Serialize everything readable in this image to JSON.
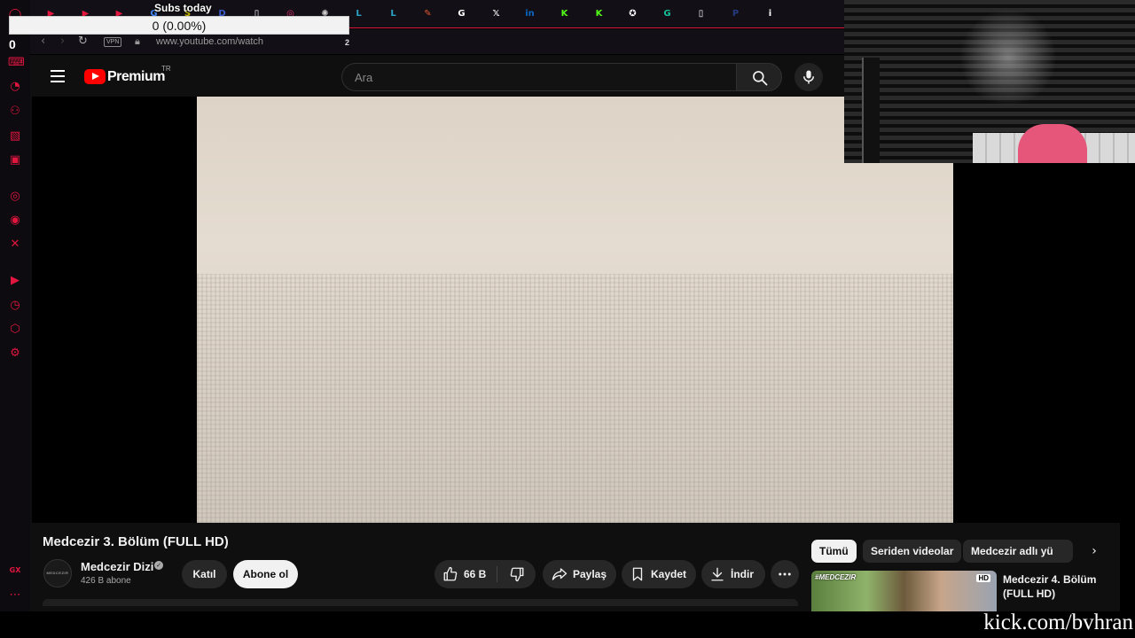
{
  "overlay": {
    "subs_title": "Subs today",
    "subs_progress_text": "0 (0.00%)",
    "subs_progress_fraction": 0.0,
    "stream_counter": "0",
    "watermark": "kick.com/bvhran"
  },
  "browser": {
    "url": "www.youtube.com/watch",
    "vpn_label": "VPN",
    "tab_count": "2",
    "accent_color": "#e0163f",
    "tabs": [
      {
        "icon": "youtube-icon",
        "glyph": "▶",
        "color": "#e0163f"
      },
      {
        "icon": "youtube-icon",
        "glyph": "▶",
        "color": "#e0163f"
      },
      {
        "icon": "youtube-icon",
        "glyph": "▶",
        "color": "#e0163f"
      },
      {
        "icon": "google-icon",
        "glyph": "G",
        "color": "#4285f4"
      },
      {
        "icon": "steam-icon",
        "glyph": "S",
        "color": "#c7b800"
      },
      {
        "icon": "document-icon",
        "glyph": "D",
        "color": "#3b5bcc"
      },
      {
        "icon": "file-icon",
        "glyph": "▯",
        "color": "#ffffff"
      },
      {
        "icon": "instagram-icon",
        "glyph": "◎",
        "color": "#e1306c"
      },
      {
        "icon": "chatgpt-icon",
        "glyph": "✺",
        "color": "#cccccc"
      },
      {
        "icon": "letter-l-icon",
        "glyph": "L",
        "color": "#2aa3c7"
      },
      {
        "icon": "letter-l-icon",
        "glyph": "L",
        "color": "#2aa3c7"
      },
      {
        "icon": "paint-icon",
        "glyph": "✎",
        "color": "#e4572e"
      },
      {
        "icon": "google-icon",
        "glyph": "G",
        "color": "#ffffff"
      },
      {
        "icon": "x-icon",
        "glyph": "𝕏",
        "color": "#ffffff"
      },
      {
        "icon": "linkedin-icon",
        "glyph": "in",
        "color": "#0a66c2"
      },
      {
        "icon": "kick-icon",
        "glyph": "K",
        "color": "#53fc18"
      },
      {
        "icon": "kick-icon",
        "glyph": "K",
        "color": "#53fc18"
      },
      {
        "icon": "star-icon",
        "glyph": "✪",
        "color": "#ffffff"
      },
      {
        "icon": "grammarly-icon",
        "glyph": "G",
        "color": "#15c39a"
      },
      {
        "icon": "file-icon",
        "glyph": "▯",
        "color": "#ffffff"
      },
      {
        "icon": "paypal-icon",
        "glyph": "P",
        "color": "#253b80"
      },
      {
        "icon": "info-icon",
        "glyph": "i",
        "color": "#ffffff"
      }
    ],
    "sidebar_icons": [
      {
        "icon": "game-controller-icon",
        "glyph": "⌨"
      },
      {
        "icon": "speed-icon",
        "glyph": "◔"
      },
      {
        "icon": "bot-icon",
        "glyph": "⚇"
      },
      {
        "icon": "twitch-icon",
        "glyph": "▧"
      },
      {
        "icon": "mail-icon",
        "glyph": "▣"
      },
      {
        "icon": "instagram-icon",
        "glyph": "◎"
      },
      {
        "icon": "whatsapp-icon",
        "glyph": "◉"
      },
      {
        "icon": "x-icon",
        "glyph": "✕"
      },
      {
        "icon": "player-icon",
        "glyph": "▶"
      },
      {
        "icon": "history-icon",
        "glyph": "◷"
      },
      {
        "icon": "extensions-icon",
        "glyph": "⬡"
      },
      {
        "icon": "settings-icon",
        "glyph": "⚙"
      },
      {
        "icon": "gx-icon",
        "glyph": "GX"
      },
      {
        "icon": "more-icon",
        "glyph": "⋯"
      }
    ]
  },
  "youtube": {
    "logo_text": "Premium",
    "logo_region": "TR",
    "brand_color": "#ff0000",
    "search_placeholder": "Ara",
    "video": {
      "title": "Medcezir 3. Bölüm (FULL HD)",
      "channel": "Medcezir Dizi",
      "avatar_text": "MEDCEZIR",
      "subscribers": "426 B abone",
      "join_label": "Katıl",
      "subscribe_label": "Abone ol",
      "like_count": "66 B",
      "share_label": "Paylaş",
      "save_label": "Kaydet",
      "download_label": "İndir"
    },
    "chips": [
      "Tümü",
      "Seriden videolar",
      "Medcezir adlı yü"
    ],
    "recommendation": {
      "thumb_tag": "#MEDCEZIR",
      "thumb_badge": "HD",
      "title": "Medcezir 4. Bölüm (FULL HD)"
    }
  }
}
